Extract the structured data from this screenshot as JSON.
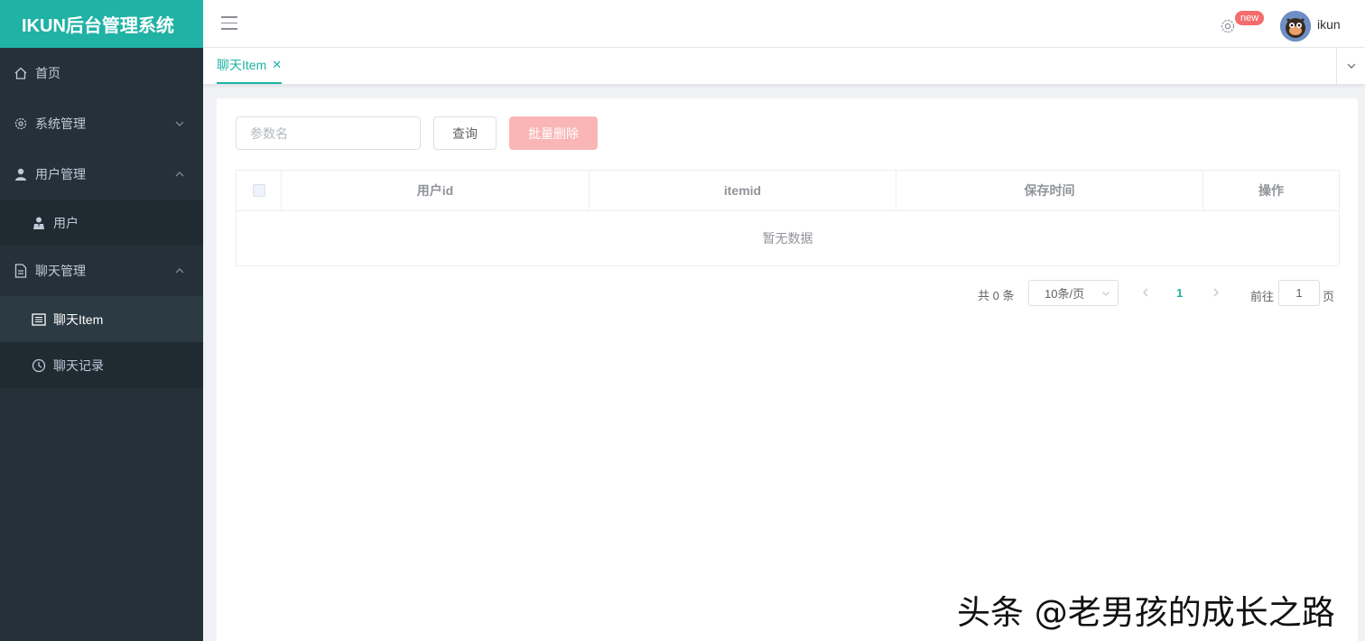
{
  "app": {
    "title": "IKUN后台管理系统"
  },
  "sidebar": {
    "items": [
      {
        "label": "首页",
        "icon": "home-icon"
      },
      {
        "label": "系统管理",
        "icon": "gear-icon",
        "expanded": false
      },
      {
        "label": "用户管理",
        "icon": "user-icon",
        "expanded": true,
        "children": [
          {
            "label": "用户",
            "icon": "user-tie-icon"
          }
        ]
      },
      {
        "label": "聊天管理",
        "icon": "document-icon",
        "expanded": true,
        "children": [
          {
            "label": "聊天Item",
            "icon": "list-box-icon",
            "active": true
          },
          {
            "label": "聊天记录",
            "icon": "clock-icon"
          }
        ]
      }
    ]
  },
  "header": {
    "badge": "new",
    "username": "ikun"
  },
  "tabs": [
    {
      "label": "聊天Item",
      "active": true,
      "closable": true
    }
  ],
  "toolbar": {
    "search_placeholder": "参数名",
    "search_value": "",
    "query_label": "查询",
    "batch_delete_label": "批量删除"
  },
  "table": {
    "columns": [
      "用户id",
      "itemid",
      "保存时间",
      "操作"
    ],
    "rows": [],
    "empty_text": "暂无数据"
  },
  "pagination": {
    "total_text": "共 0 条",
    "page_size": "10条/页",
    "current_page": "1",
    "goto_label": "前往",
    "goto_value": "1",
    "goto_unit": "页"
  },
  "watermark": "头条 @老男孩的成长之路",
  "colors": {
    "accent": "#20b2a4",
    "sidebar": "#253139",
    "danger_light": "#fab6b6",
    "badge": "#f56c6c"
  }
}
